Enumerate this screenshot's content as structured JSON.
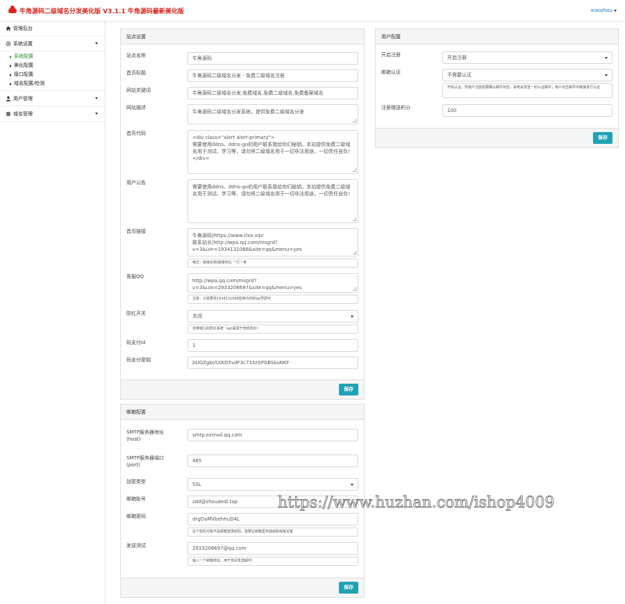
{
  "header": {
    "brand_title": "牛角源码二级域名分发美化版 V3.1.1 牛角源码最新美化版",
    "user_name": "xiaozhou",
    "brand_color": "#d9251d"
  },
  "sidebar": {
    "admin_home": "管理后台",
    "system_settings": "系统设置",
    "sub_items": [
      "系统配置",
      "美化配置",
      "接口配置",
      "域名配置/检测"
    ],
    "user_management": "用户管理",
    "domain_management": "域名管理",
    "active_color": "#2a8d2a"
  },
  "site_settings": {
    "title": "站点设置",
    "fields": {
      "site_name_label": "站点名称",
      "site_name_value": "牛角源码",
      "home_title_label": "首页标题",
      "home_title_value": "牛角源码二级域名分发 - 免费二级域名注册",
      "keywords_label": "网站关键词",
      "keywords_value": "牛角源码二级域名分发,免费域名,免费二级域名,免费备案域名",
      "description_label": "网站描述",
      "description_value": "牛角源码二级域名分发系统，提供免费二级域名分发",
      "home_code_label": "首页代码",
      "home_code_value": "<div class=\"alert alert-primary\">\n需要使用ddns、ddns-go的用户联系我给你们秘钥。本站提供免费二级域名用于测试、学习等，请勿将二级域名用于一切非法用途，一切责任自负!\n</div>",
      "notice_label": "用户公告",
      "notice_value": "需要使用ddns、ddns-go的用户联系我给你们秘钥。本站提供免费二级域名用于测试、学习等，请勿将二级域名用于一切非法用途，一切责任自负!",
      "links_label": "首页链接",
      "links_value": "牛角源码|https://www.rlxx.vip/\n联系站长|http://wpa.qq.com/msgrd?v=3&uin=1934131068&site=qq&menu=yes",
      "links_help": "格式：链接名称|链接地址 一行一条",
      "qq_label": "客服QQ",
      "qq_value": "http://wpa.qq.com/msgrd?v=3&uin=2933206697&site=qq&menu=yes",
      "qq_help": "注意：只需要将1934131068替换为你的qq号即可",
      "antired_label": "防红开关",
      "antired_value": "关闭",
      "antired_help": "自带接口的防红系统（api来源于竞帆防红）",
      "pay_id_label": "码支付id",
      "pay_id_value": "1",
      "pay_key_label": "码支付密钥",
      "pay_key_value": "bUGZgkoSXKD5vdF3c733zXPGBSkuNKF"
    },
    "save_label": "保存"
  },
  "mail_settings": {
    "title": "邮箱配置",
    "fields": {
      "host_label": "SMTP服务器地址\n(host)",
      "host_value": "smtp.exmail.qq.com",
      "port_label": "SMTP服务器端口\n(port)",
      "port_value": "465",
      "enc_label": "加密类型",
      "enc_value": "SSL",
      "account_label": "邮箱账号",
      "account_value": "zdd@zhoudedi.top",
      "password_label": "邮箱密码",
      "password_value": "drgDaMVbehhuD4L",
      "password_help": "这个密码可能不是邮箱登录密码，需要在邮箱里单独获取或者设置",
      "test_label": "发送测试",
      "test_value": "2933206697@qq.com",
      "test_help": "输入一个邮箱地址，用于测试发送邮件!"
    },
    "save_label": "保存"
  },
  "user_settings": {
    "title": "用户配置",
    "fields": {
      "register_label": "开启注册",
      "register_value": "开启注册",
      "mail_verify_label": "邮箱认证",
      "mail_verify_value": "不需要认证",
      "mail_verify_help": "开启认证，则用户注册需要确认邮件状态，系统会发送一封认证邮件，用户点击邮件中链接进行认证",
      "points_label": "注册赠送积分",
      "points_value": "100"
    },
    "save_label": "保存"
  },
  "watermark": "https://www.huzhan.com/ishop4009",
  "accent_color": "#1fa2b3"
}
